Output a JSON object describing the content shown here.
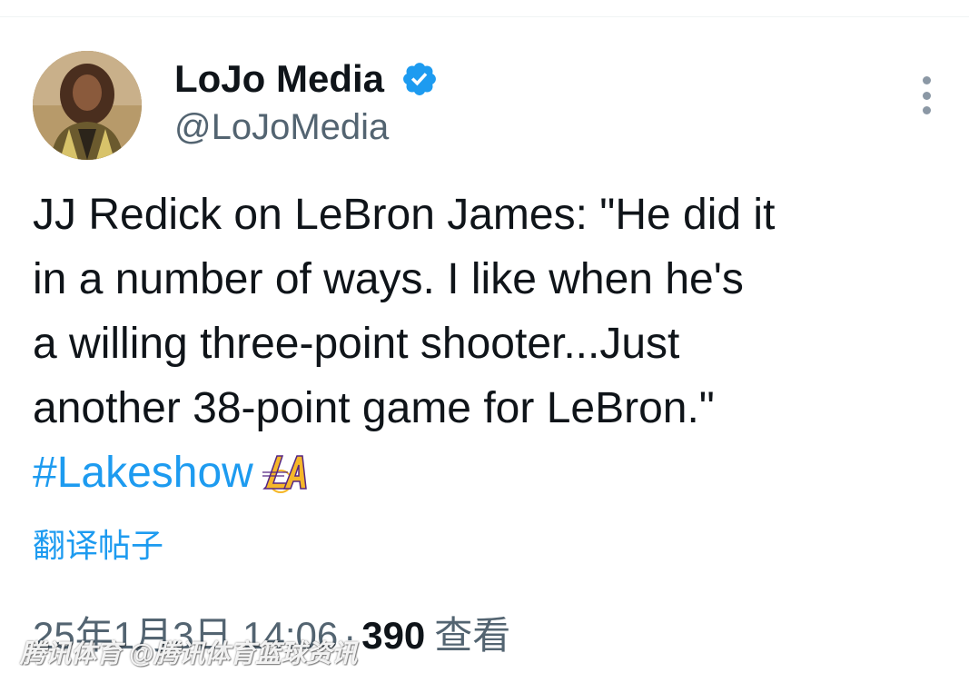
{
  "author": {
    "display_name": "LoJo Media",
    "handle": "@LoJoMedia",
    "verified": true,
    "avatar_alt": "profile photo"
  },
  "tweet": {
    "lines": [
      "JJ Redick on LeBron James: \"He did it",
      "in a number of ways. I like when he's",
      "a willing three-point shooter...Just",
      "another 38-point game for LeBron.\""
    ],
    "hashtag": "#Lakeshow",
    "emoji_icon": "lakers-logo-icon"
  },
  "translate_label": "翻译帖子",
  "meta": {
    "timestamp": "25年1月3日 14:06",
    "separator": "·",
    "views_count": "390",
    "views_label": "查看"
  },
  "watermark": "腾讯体育 @腾讯体育篮球资讯",
  "colors": {
    "link": "#1d9bf0",
    "secondary_text": "#536471",
    "primary_text": "#0f1419",
    "lakers_gold": "#f5b72a",
    "lakers_purple": "#552583"
  }
}
